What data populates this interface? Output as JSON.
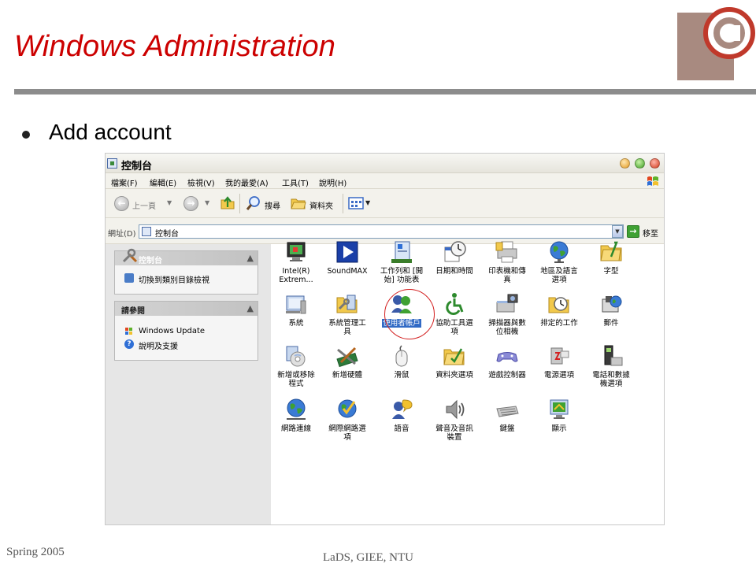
{
  "slide": {
    "title": "Windows Administration",
    "bullet": "Add account",
    "footer_left": "Spring 2005",
    "footer_center": "LaDS, GIEE, NTU"
  },
  "window": {
    "title": "控制台",
    "menu": [
      "檔案(F)",
      "編輯(E)",
      "檢視(V)",
      "我的最愛(A)",
      "工具(T)",
      "說明(H)"
    ],
    "toolbar": {
      "back": "上一頁",
      "search": "搜尋",
      "folders": "資料夾"
    },
    "address": {
      "label": "網址(D)",
      "value": "控制台",
      "go": "移至"
    }
  },
  "sidebar": {
    "panel1": {
      "title": "控制台",
      "link": "切換到類別目錄檢視"
    },
    "panel2": {
      "title": "請參閱",
      "links": [
        "Windows Update",
        "說明及支援"
      ]
    }
  },
  "items": [
    {
      "label1": "Intel(R)",
      "label2": "Extrem...",
      "icon": "monitor-icon"
    },
    {
      "label1": "SoundMAX",
      "label2": "",
      "icon": "soundmax-icon"
    },
    {
      "label1": "工作列和 [開",
      "label2": "始] 功能表",
      "icon": "taskbar-icon"
    },
    {
      "label1": "日期和時間",
      "label2": "",
      "icon": "clock-icon"
    },
    {
      "label1": "印表機和傳",
      "label2": "真",
      "icon": "printer-icon"
    },
    {
      "label1": "地區及語言",
      "label2": "選項",
      "icon": "globe-icon"
    },
    {
      "label1": "字型",
      "label2": "",
      "icon": "fonts-folder-icon"
    },
    {
      "label1": "系統",
      "label2": "",
      "icon": "system-icon"
    },
    {
      "label1": "系統管理工",
      "label2": "具",
      "icon": "admin-tools-icon"
    },
    {
      "label1": "使用者帳戶",
      "label2": "",
      "icon": "user-accounts-icon"
    },
    {
      "label1": "協助工具選",
      "label2": "項",
      "icon": "accessibility-icon"
    },
    {
      "label1": "掃描器與數",
      "label2": "位相機",
      "icon": "scanner-icon"
    },
    {
      "label1": "排定的工作",
      "label2": "",
      "icon": "scheduled-tasks-icon"
    },
    {
      "label1": "郵件",
      "label2": "",
      "icon": "mail-icon"
    },
    {
      "label1": "新增或移除",
      "label2": "程式",
      "icon": "add-remove-icon"
    },
    {
      "label1": "新增硬體",
      "label2": "",
      "icon": "add-hardware-icon"
    },
    {
      "label1": "滑鼠",
      "label2": "",
      "icon": "mouse-icon"
    },
    {
      "label1": "資料夾選項",
      "label2": "",
      "icon": "folder-options-icon"
    },
    {
      "label1": "遊戲控制器",
      "label2": "",
      "icon": "game-controller-icon"
    },
    {
      "label1": "電源選項",
      "label2": "",
      "icon": "power-icon"
    },
    {
      "label1": "電話和數據",
      "label2": "機選項",
      "icon": "phone-modem-icon"
    },
    {
      "label1": "網路連線",
      "label2": "",
      "icon": "network-icon"
    },
    {
      "label1": "網際網路選",
      "label2": "項",
      "icon": "internet-options-icon"
    },
    {
      "label1": "語音",
      "label2": "",
      "icon": "speech-icon"
    },
    {
      "label1": "聲音及音訊",
      "label2": "裝置",
      "icon": "speaker-icon"
    },
    {
      "label1": "鍵盤",
      "label2": "",
      "icon": "keyboard-icon"
    },
    {
      "label1": "顯示",
      "label2": "",
      "icon": "display-icon"
    }
  ],
  "selected_item": "使用者帳戶",
  "colors": {
    "title": "#cc0000",
    "selection": "#316ac5",
    "highlight_circle": "#d32020"
  }
}
